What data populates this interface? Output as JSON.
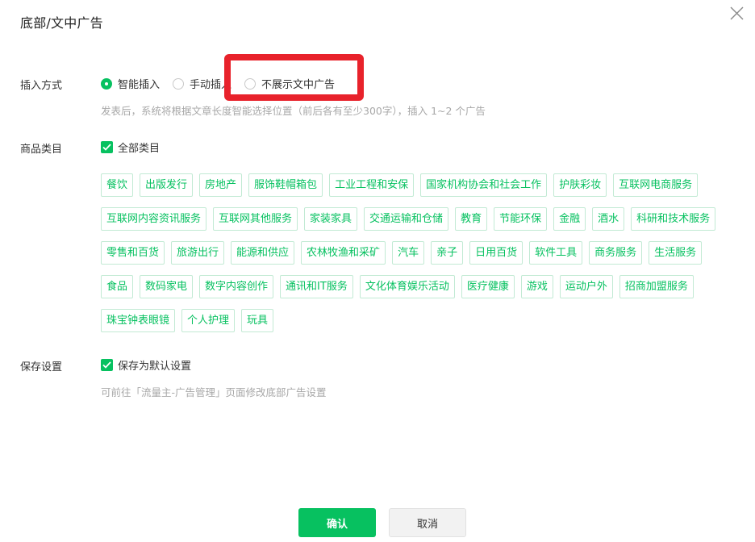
{
  "dialog": {
    "title": "底部/文中广告"
  },
  "insert_mode": {
    "label": "插入方式",
    "options": [
      {
        "label": "智能插入",
        "selected": true
      },
      {
        "label": "手动插入",
        "selected": false
      },
      {
        "label": "不展示文中广告",
        "selected": false
      }
    ],
    "hint": "发表后，系统将根据文章长度智能选择位置（前后各有至少300字），插入 1~2 个广告"
  },
  "category": {
    "label": "商品类目",
    "all_label": "全部类目",
    "all_checked": true,
    "tags": [
      "餐饮",
      "出版发行",
      "房地产",
      "服饰鞋帽箱包",
      "工业工程和安保",
      "国家机构协会和社会工作",
      "护肤彩妆",
      "互联网电商服务",
      "互联网内容资讯服务",
      "互联网其他服务",
      "家装家具",
      "交通运输和仓储",
      "教育",
      "节能环保",
      "金融",
      "酒水",
      "科研和技术服务",
      "零售和百货",
      "旅游出行",
      "能源和供应",
      "农林牧渔和采矿",
      "汽车",
      "亲子",
      "日用百货",
      "软件工具",
      "商务服务",
      "生活服务",
      "食品",
      "数码家电",
      "数字内容创作",
      "通讯和IT服务",
      "文化体育娱乐活动",
      "医疗健康",
      "游戏",
      "运动户外",
      "招商加盟服务",
      "珠宝钟表眼镜",
      "个人护理",
      "玩具"
    ]
  },
  "save": {
    "label": "保存设置",
    "checkbox_label": "保存为默认设置",
    "checked": true,
    "hint": "可前往「流量主-广告管理」页面修改底部广告设置"
  },
  "footer": {
    "confirm_label": "确认",
    "cancel_label": "取消"
  },
  "colors": {
    "accent": "#07c160",
    "highlight": "#e8222b"
  }
}
